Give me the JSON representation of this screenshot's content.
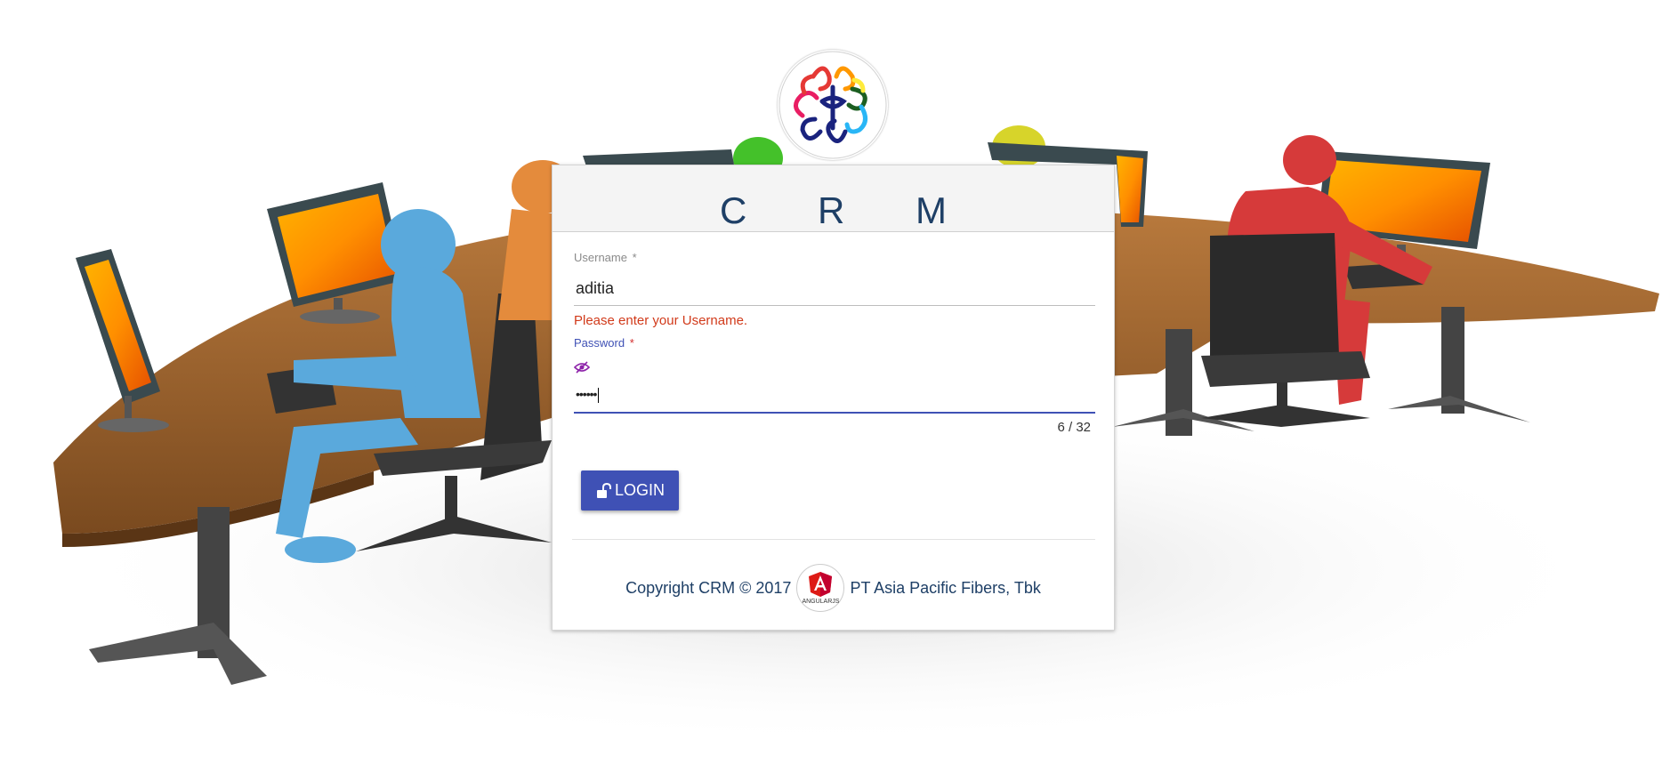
{
  "app": {
    "title": "C R M"
  },
  "form": {
    "username_label": "Username",
    "username_value": "aditia",
    "username_error": "Please enter your Username.",
    "password_label": "Password",
    "required_marker": "*",
    "password_masked": "••••••",
    "char_counter": "6 / 32",
    "login_button_label": "LOGIN"
  },
  "footer": {
    "copyright_text": "Copyright CRM © 2017",
    "company_text": "PT Asia Pacific Fibers, Tbk",
    "badge_text": "ANGULARJS"
  },
  "icons": {
    "logo": "colorful-knot-logo",
    "password_toggle": "eye-slash-icon",
    "login": "unlock-icon",
    "badge": "angular-icon"
  },
  "colors": {
    "primary": "#3f51b5",
    "title": "#1e3f66",
    "error": "#d13a1a",
    "angular_red": "#dd1b16"
  }
}
